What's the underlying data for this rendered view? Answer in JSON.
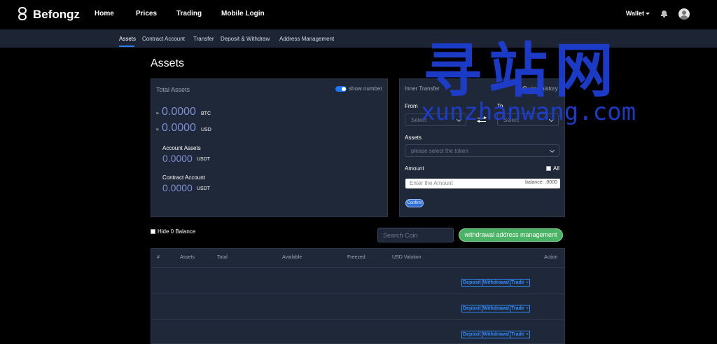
{
  "brand": {
    "name": "Befongz"
  },
  "topnav": {
    "items": [
      {
        "label": "Home"
      },
      {
        "label": "Prices"
      },
      {
        "label": "Trading"
      },
      {
        "label": "Mobile Login"
      }
    ],
    "wallet_label": "Wallet"
  },
  "subnav": {
    "items": [
      {
        "label": "Assets"
      },
      {
        "label": "Contract Account"
      },
      {
        "label": "Transfer"
      },
      {
        "label": "Deposit & Withdraw"
      },
      {
        "label": "Address Management"
      }
    ],
    "active": "Assets"
  },
  "page_title": "Assets",
  "total_assets": {
    "title": "Total Assets",
    "show_number_label": "show number",
    "show_number_on": true,
    "approx": "≈",
    "btc_value": "0.0000",
    "btc_unit": "BTC",
    "usd_value": "0.0000",
    "usd_unit": "USD",
    "account_assets_label": "Account Assets",
    "account_assets_value": "0.0000",
    "account_assets_unit": "USDT",
    "contract_account_label": "Contract Account",
    "contract_account_value": "0.0000",
    "contract_account_unit": "USDT"
  },
  "inner_transfer": {
    "title": "Inner Transfer",
    "view_history": "view history",
    "from_label": "From",
    "to_label": "To",
    "from_placeholder": "Select",
    "to_placeholder": "Select",
    "assets_label": "Assets",
    "token_placeholder": "please select the token",
    "amount_label": "Amount",
    "all_label": "All",
    "amount_placeholder": "Enter the Amount",
    "balance_text": "balance: .0000",
    "confirm_label": "Confirm"
  },
  "filters": {
    "hide_zero_label": "Hide 0 Balance",
    "search_placeholder": "Search Coin",
    "address_button": "withdrawal address management"
  },
  "table": {
    "headers": [
      "#",
      "Assets",
      "Total",
      "Available",
      "Freezed",
      "USD Valution",
      "Action"
    ],
    "rows": [
      {
        "actions": [
          "Deposit",
          "Withdrawal",
          "Trade"
        ]
      },
      {
        "actions": [
          "Deposit",
          "Withdrawal",
          "Trade"
        ]
      },
      {
        "actions": [
          "Deposit",
          "Withdrawal",
          "Trade"
        ]
      }
    ]
  },
  "watermark": {
    "chinese": "寻站网",
    "latin": "xunzhanwang.com"
  },
  "colors": {
    "accent": "#2f7cf6",
    "number": "#7f8fd4",
    "green_button": "#4bb366",
    "card": "#1f2838",
    "subnav": "#1d2535",
    "watermark": "#1d3fd1"
  }
}
